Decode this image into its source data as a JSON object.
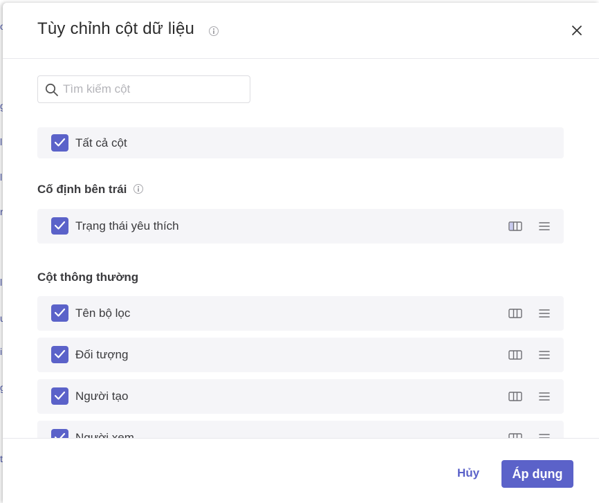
{
  "modal": {
    "title": "Tùy chỉnh cột dữ liệu",
    "search": {
      "placeholder": "Tìm kiếm cột",
      "value": ""
    },
    "select_all": {
      "label": "Tất cả cột",
      "checked": true
    },
    "sections": [
      {
        "title": "Cố định bên trái",
        "has_info_icon": true,
        "items": [
          {
            "label": "Trạng thái yêu thích",
            "checked": true,
            "pinned": true
          }
        ]
      },
      {
        "title": "Cột thông thường",
        "has_info_icon": false,
        "items": [
          {
            "label": "Tên bộ lọc",
            "checked": true,
            "pinned": false
          },
          {
            "label": "Đối tượng",
            "checked": true,
            "pinned": false
          },
          {
            "label": "Người tạo",
            "checked": true,
            "pinned": false
          },
          {
            "label": "Người xem",
            "checked": true,
            "pinned": false
          }
        ]
      }
    ],
    "footer": {
      "cancel_label": "Hủy",
      "apply_label": "Áp dụng"
    }
  },
  "icons": {
    "close": "close-icon",
    "info": "info-icon",
    "search": "search-icon",
    "checkbox": "checkbox-checked-icon",
    "pin": "pin-column-icon",
    "drag": "drag-handle-icon"
  },
  "colors": {
    "accent": "#5b62c9",
    "row_background": "#f5f5f8",
    "pinned_icon_fill": "#c9cbee"
  }
}
